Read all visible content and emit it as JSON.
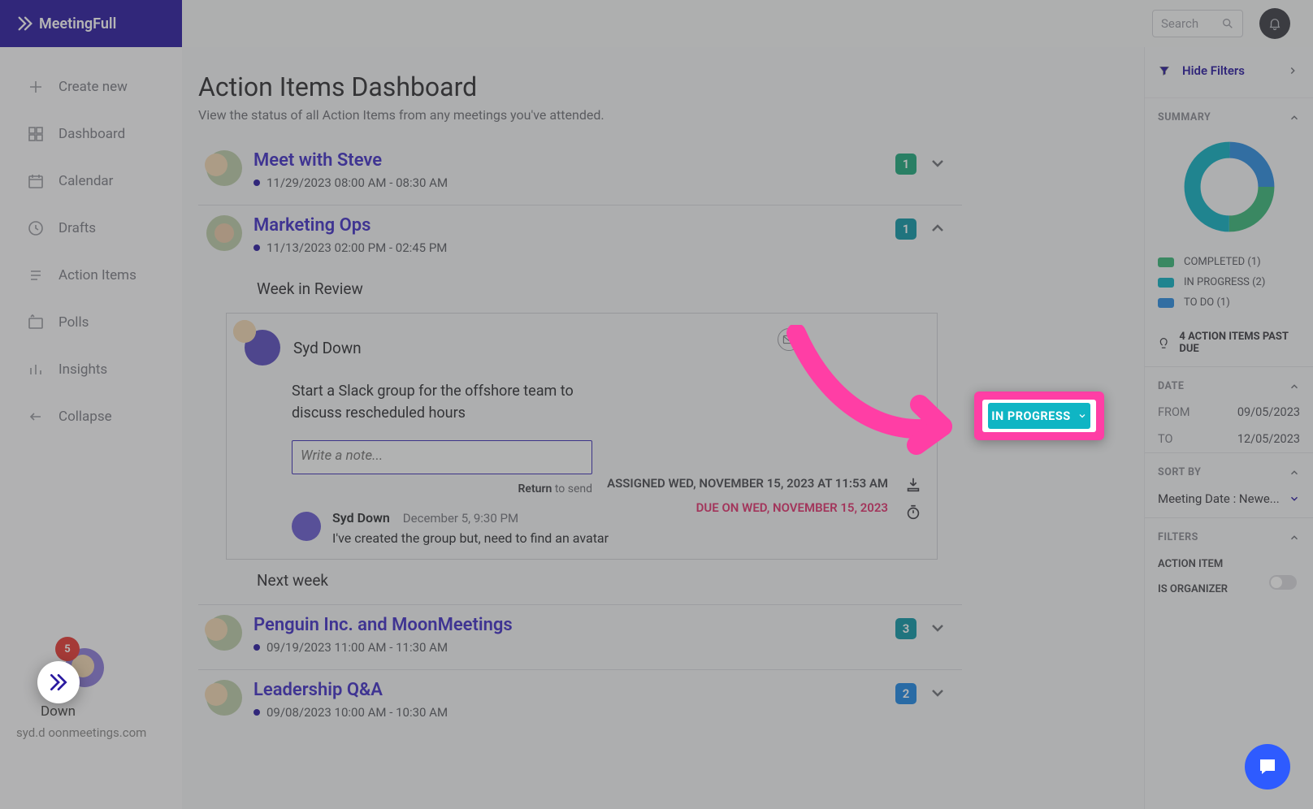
{
  "brand": {
    "name": "MeetingFull"
  },
  "sidebar": {
    "items": [
      {
        "label": "Create new",
        "icon": "plus-icon"
      },
      {
        "label": "Dashboard",
        "icon": "grid-icon"
      },
      {
        "label": "Calendar",
        "icon": "calendar-icon"
      },
      {
        "label": "Drafts",
        "icon": "clock-icon"
      },
      {
        "label": "Action Items",
        "icon": "list-icon"
      },
      {
        "label": "Polls",
        "icon": "polls-icon"
      },
      {
        "label": "Insights",
        "icon": "bars-icon"
      },
      {
        "label": "Collapse",
        "icon": "arrow-left-icon"
      }
    ],
    "profile_partial_name": "Down",
    "profile_partial_email": "syd.d            oonmeetings.com",
    "notif_count": "5"
  },
  "topbar": {
    "search_placeholder": "Search"
  },
  "page": {
    "title": "Action Items Dashboard",
    "subtitle": "View the status of all Action Items from any meetings you've attended."
  },
  "meetings": [
    {
      "title": "Meet with Steve",
      "time": "11/29/2023 08:00 AM - 08:30 AM",
      "badge": "1",
      "badge_class": "badge-green",
      "expanded": false
    },
    {
      "title": "Marketing Ops",
      "time": "11/13/2023 02:00 PM - 02:45 PM",
      "badge": "1",
      "badge_class": "badge-teal-dark",
      "expanded": true
    },
    {
      "title": "Penguin Inc. and MoonMeetings",
      "time": "09/19/2023 11:00 AM - 11:30 AM",
      "badge": "3",
      "badge_class": "badge-teal-dark",
      "expanded": false
    },
    {
      "title": "Leadership Q&A",
      "time": "09/08/2023 10:00 AM - 10:30 AM",
      "badge": "2",
      "badge_class": "badge-blue",
      "expanded": false
    }
  ],
  "expanded": {
    "section1": "Week in Review",
    "assignee": "Syd Down",
    "desc": "Start a Slack group for the offshore team to discuss rescheduled hours",
    "note_placeholder": "Write a note...",
    "return_hint_bold": "Return",
    "return_hint_rest": " to send",
    "comment_name": "Syd Down",
    "comment_date": "December 5, 9:30 PM",
    "comment_text": "I've created the group but, need to find an avatar",
    "assigned_line": "ASSIGNED WED, NOVEMBER 15, 2023 AT 11:53 AM",
    "due_line": "DUE ON WED, NOVEMBER 15, 2023",
    "section2": "Next week",
    "status_button": "IN PROGRESS"
  },
  "filters": {
    "hide_label": "Hide Filters",
    "summary_head": "SUMMARY",
    "legend": [
      {
        "label": "COMPLETED (1)",
        "class": "sw-green"
      },
      {
        "label": "IN PROGRESS (2)",
        "class": "sw-teal"
      },
      {
        "label": "TO DO (1)",
        "class": "sw-blue"
      }
    ],
    "past_due": "4 ACTION ITEMS PAST DUE",
    "date_head": "DATE",
    "from_label": "FROM",
    "from_value": "09/05/2023",
    "to_label": "TO",
    "to_value": "12/05/2023",
    "sort_head": "SORT BY",
    "sort_value": "Meeting Date : Newe...",
    "filters_head": "FILTERS",
    "action_item_label": "ACTION ITEM",
    "is_organizer_label": "IS ORGANIZER"
  },
  "chart_data": {
    "type": "pie",
    "title": "",
    "series": [
      {
        "name": "COMPLETED",
        "value": 1,
        "color": "#39b77a"
      },
      {
        "name": "IN PROGRESS",
        "value": 2,
        "color": "#10b0c2"
      },
      {
        "name": "TO DO",
        "value": 1,
        "color": "#2d8de0"
      }
    ]
  }
}
